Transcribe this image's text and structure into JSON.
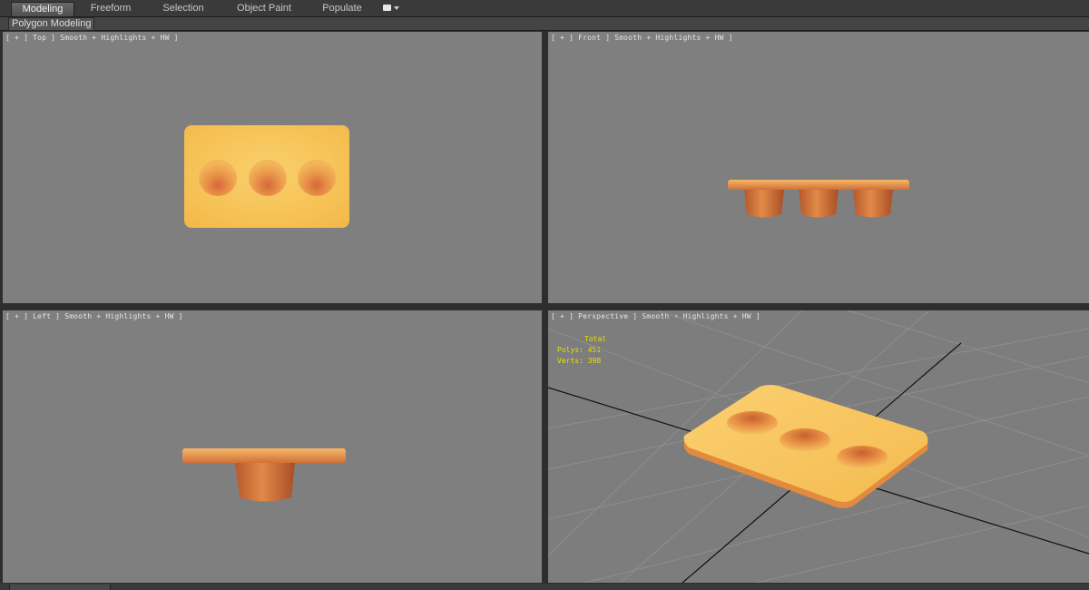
{
  "ribbon": {
    "tabs": [
      {
        "label": "Modeling",
        "active": true
      },
      {
        "label": "Freeform",
        "active": false
      },
      {
        "label": "Selection",
        "active": false
      },
      {
        "label": "Object Paint",
        "active": false
      },
      {
        "label": "Populate",
        "active": false
      }
    ],
    "dropdown_icon": "ribbon-dropdown-icon"
  },
  "sub_ribbon": {
    "panel_label": "Polygon Modeling"
  },
  "viewports": {
    "top": {
      "label": "[ + ] Top ] Smooth + Highlights + HW ]"
    },
    "front": {
      "label": "[ + ] Front ] Smooth + Highlights + HW ]"
    },
    "left": {
      "label": "[ + ] Left ] Smooth + Highlights + HW ]"
    },
    "perspective": {
      "label": "[ + ] Perspective ] Smooth + Highlights + HW ]",
      "stats": {
        "total_label": "Total",
        "polys": "Polys: 451",
        "verts": "Verts: 398"
      }
    }
  },
  "colors": {
    "viewport_bg": "#7f7f7f",
    "model_top": "#f8c65a",
    "model_side": "#d8743a",
    "stats_text": "#e8e000"
  }
}
